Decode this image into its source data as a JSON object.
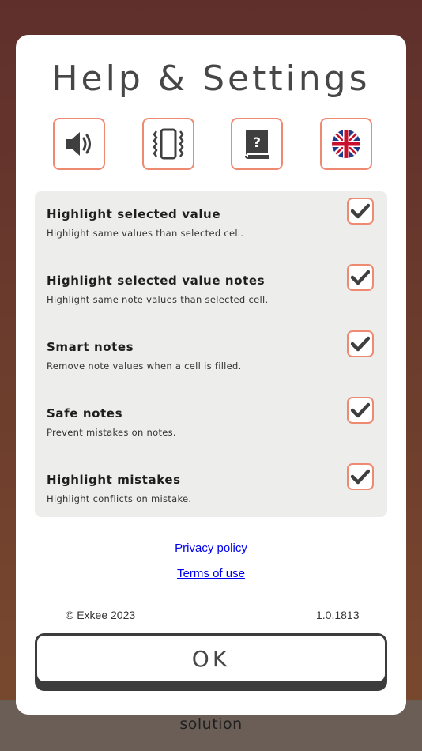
{
  "dialog": {
    "title": "Help & Settings",
    "icons": [
      {
        "name": "sound-icon"
      },
      {
        "name": "vibration-icon"
      },
      {
        "name": "help-book-icon"
      },
      {
        "name": "uk-flag-icon"
      }
    ],
    "settings": [
      {
        "title": "Highlight selected value",
        "desc": "Highlight same values than selected cell.",
        "checked": true
      },
      {
        "title": "Highlight selected value notes",
        "desc": "Highlight same note values than selected cell.",
        "checked": true
      },
      {
        "title": "Smart notes",
        "desc": "Remove note values when a cell is filled.",
        "checked": true
      },
      {
        "title": "Safe notes",
        "desc": "Prevent mistakes on notes.",
        "checked": true
      },
      {
        "title": "Highlight mistakes",
        "desc": "Highlight conflicts on mistake.",
        "checked": true
      }
    ],
    "links": {
      "privacy": "Privacy policy",
      "terms": "Terms of use"
    },
    "copyright": "© Exkee 2023",
    "version": "1.0.1813",
    "ok_label": "OK"
  },
  "background": {
    "bottom_label": "solution"
  },
  "colors": {
    "accent": "#ef8a72",
    "panel": "#ededeb",
    "text": "#474747"
  }
}
